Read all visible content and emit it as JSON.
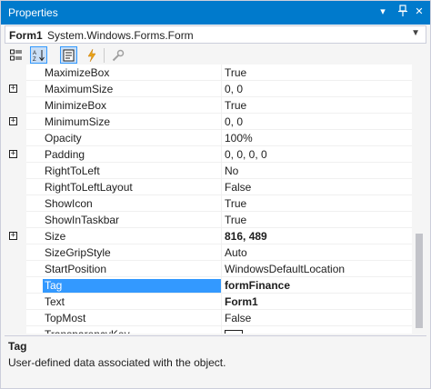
{
  "window": {
    "title": "Properties"
  },
  "titlebar_icons": {
    "dropdown": "▾",
    "pin": "pin-icon",
    "close": "✕"
  },
  "selector": {
    "object_name": "Form1",
    "object_type": "System.Windows.Forms.Form"
  },
  "toolbar": {
    "buttons": [
      "categorized-icon",
      "alphabetical-icon",
      "properties-icon",
      "events-icon",
      "property-pages-icon"
    ],
    "active": [
      "alphabetical-icon",
      "properties-icon"
    ]
  },
  "properties": [
    {
      "name": "MaximizeBox",
      "value": "True",
      "expandable": false
    },
    {
      "name": "MaximumSize",
      "value": "0, 0",
      "expandable": true
    },
    {
      "name": "MinimizeBox",
      "value": "True",
      "expandable": false
    },
    {
      "name": "MinimumSize",
      "value": "0, 0",
      "expandable": true
    },
    {
      "name": "Opacity",
      "value": "100%",
      "expandable": false
    },
    {
      "name": "Padding",
      "value": "0, 0, 0, 0",
      "expandable": true
    },
    {
      "name": "RightToLeft",
      "value": "No",
      "expandable": false
    },
    {
      "name": "RightToLeftLayout",
      "value": "False",
      "expandable": false
    },
    {
      "name": "ShowIcon",
      "value": "True",
      "expandable": false
    },
    {
      "name": "ShowInTaskbar",
      "value": "True",
      "expandable": false
    },
    {
      "name": "Size",
      "value": "816, 489",
      "expandable": true,
      "bold": true
    },
    {
      "name": "SizeGripStyle",
      "value": "Auto",
      "expandable": false
    },
    {
      "name": "StartPosition",
      "value": "WindowsDefaultLocation",
      "expandable": false
    },
    {
      "name": "Tag",
      "value": "formFinance",
      "expandable": false,
      "bold": true,
      "selected": true
    },
    {
      "name": "Text",
      "value": "Form1",
      "expandable": false,
      "bold": true
    },
    {
      "name": "TopMost",
      "value": "False",
      "expandable": false
    },
    {
      "name": "TransparencyKey",
      "value": "",
      "expandable": false,
      "swatch": true
    }
  ],
  "description": {
    "title": "Tag",
    "text": "User-defined data associated with the object."
  },
  "colors": {
    "accent": "#007acc",
    "selection": "#3399ff",
    "background": "#f5f5f5"
  }
}
